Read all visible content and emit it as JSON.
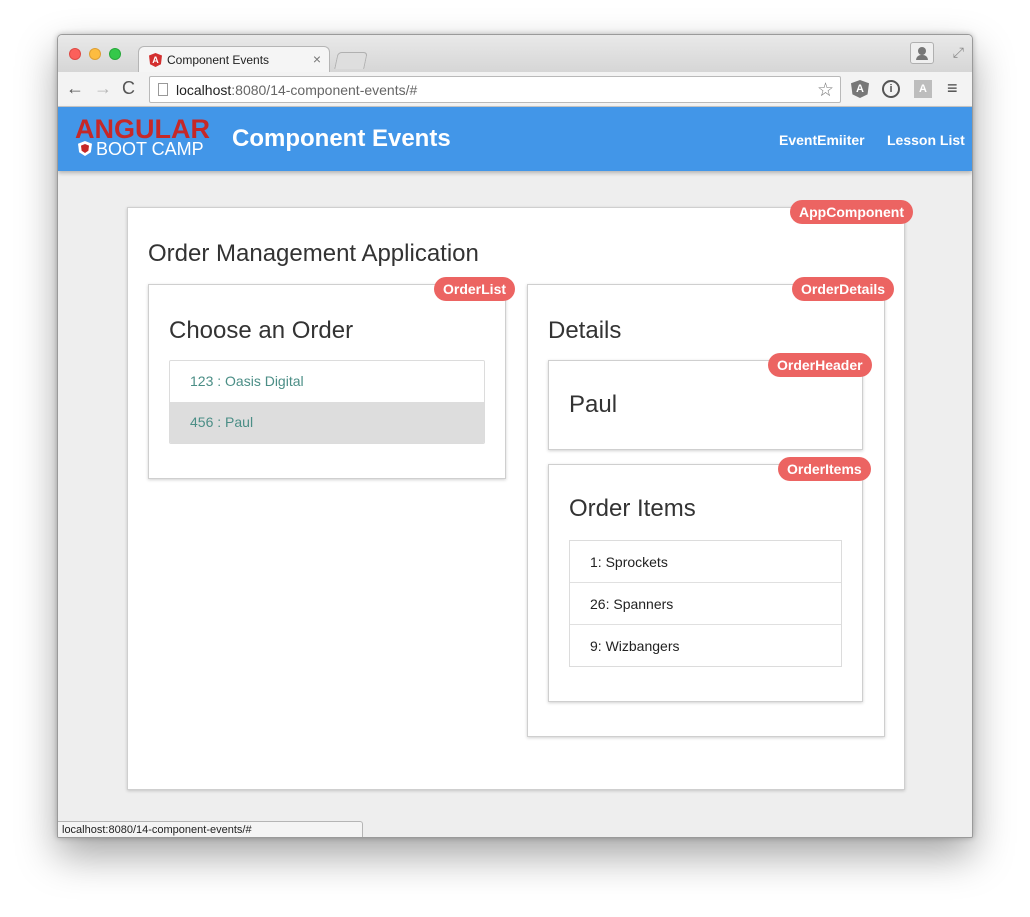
{
  "browser": {
    "tab_title": "Component Events",
    "tab_close": "×",
    "url_host": "localhost",
    "url_rest": ":8080/14-component-events/#",
    "status_url": "localhost:8080/14-component-events/#"
  },
  "icons": {
    "back": "←",
    "forward": "→",
    "reload": "C",
    "star": "☆",
    "menu": "≡",
    "fullscreen": "⤢",
    "ext_angular": "A",
    "ext_info": "i",
    "ext_a": "A",
    "favicon": "A"
  },
  "appbar": {
    "logo_top": "ANGULAR",
    "logo_bottom": "BOOT CAMP",
    "title": "Component Events",
    "nav": [
      "EventEmiiter",
      "Lesson List"
    ]
  },
  "app": {
    "badge": "AppComponent",
    "title": "Order Management Application",
    "order_list": {
      "badge": "OrderList",
      "title": "Choose an Order",
      "orders": [
        "123 : Oasis Digital",
        "456 : Paul"
      ]
    },
    "order_details": {
      "badge": "OrderDetails",
      "title": "Details",
      "header": {
        "badge": "OrderHeader",
        "name": "Paul"
      },
      "items": {
        "badge": "OrderItems",
        "title": "Order Items",
        "list": [
          "1: Sprockets",
          "26: Spanners",
          "9: Wizbangers"
        ]
      }
    }
  },
  "colors": {
    "appbar": "#4296e8",
    "badge": "#ec6462",
    "order_link": "#4b8e86",
    "logo_red": "#c62828"
  }
}
